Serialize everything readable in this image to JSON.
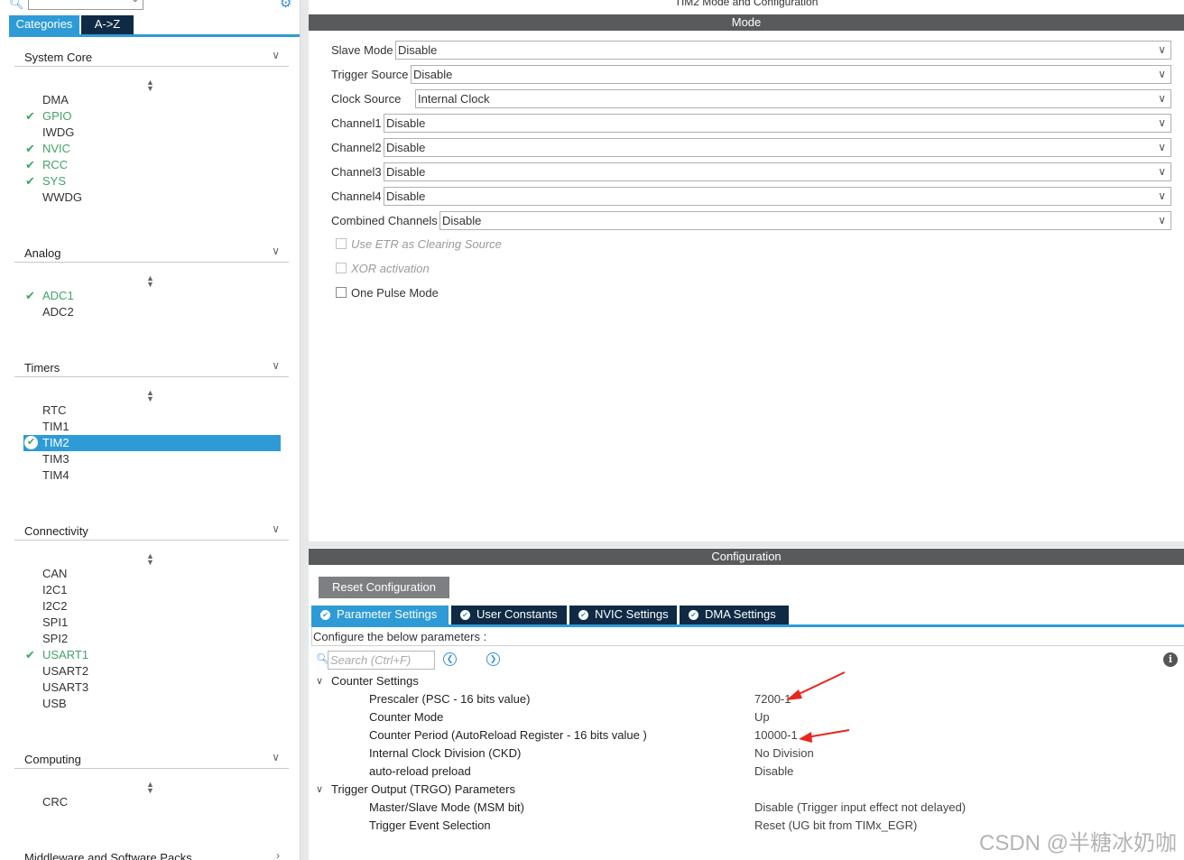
{
  "window_title": "TIM2 Mode and Configuration",
  "left": {
    "tabs": {
      "categories": "Categories",
      "az": "A->Z"
    },
    "categories": [
      {
        "name": "System Core",
        "items": [
          {
            "label": "DMA",
            "ok": false
          },
          {
            "label": "GPIO",
            "ok": true
          },
          {
            "label": "IWDG",
            "ok": false
          },
          {
            "label": "NVIC",
            "ok": true
          },
          {
            "label": "RCC",
            "ok": true
          },
          {
            "label": "SYS",
            "ok": true
          },
          {
            "label": "WWDG",
            "ok": false
          }
        ]
      },
      {
        "name": "Analog",
        "items": [
          {
            "label": "ADC1",
            "ok": true
          },
          {
            "label": "ADC2",
            "ok": false
          }
        ]
      },
      {
        "name": "Timers",
        "items": [
          {
            "label": "RTC",
            "ok": false
          },
          {
            "label": "TIM1",
            "ok": false
          },
          {
            "label": "TIM2",
            "ok": true,
            "selected": true
          },
          {
            "label": "TIM3",
            "ok": false
          },
          {
            "label": "TIM4",
            "ok": false
          }
        ]
      },
      {
        "name": "Connectivity",
        "items": [
          {
            "label": "CAN",
            "ok": false
          },
          {
            "label": "I2C1",
            "ok": false
          },
          {
            "label": "I2C2",
            "ok": false
          },
          {
            "label": "SPI1",
            "ok": false
          },
          {
            "label": "SPI2",
            "ok": false
          },
          {
            "label": "USART1",
            "ok": true
          },
          {
            "label": "USART2",
            "ok": false
          },
          {
            "label": "USART3",
            "ok": false
          },
          {
            "label": "USB",
            "ok": false
          }
        ]
      },
      {
        "name": "Computing",
        "items": [
          {
            "label": "CRC",
            "ok": false
          }
        ]
      },
      {
        "name": "Middleware and Software Packs",
        "items": []
      }
    ]
  },
  "mode": {
    "header": "Mode",
    "fields": [
      {
        "label": "Slave Mode",
        "value": "Disable"
      },
      {
        "label": "Trigger Source",
        "value": "Disable"
      },
      {
        "label": "Clock Source",
        "value": "Internal Clock"
      },
      {
        "label": "Channel1",
        "value": "Disable"
      },
      {
        "label": "Channel2",
        "value": "Disable"
      },
      {
        "label": "Channel3",
        "value": "Disable"
      },
      {
        "label": "Channel4",
        "value": "Disable"
      },
      {
        "label": "Combined Channels",
        "value": "Disable"
      }
    ],
    "checkboxes": [
      {
        "label": "Use ETR as Clearing Source",
        "disabled": true,
        "checked": false
      },
      {
        "label": "XOR activation",
        "disabled": true,
        "checked": false
      },
      {
        "label": "One Pulse Mode",
        "disabled": false,
        "checked": false
      }
    ]
  },
  "config": {
    "header": "Configuration",
    "reset_label": "Reset Configuration",
    "tabs": [
      "Parameter Settings",
      "User Constants",
      "NVIC Settings",
      "DMA Settings"
    ],
    "description": "Configure the below parameters :",
    "search_placeholder": "Search (Ctrl+F)",
    "groups": [
      {
        "name": "Counter Settings",
        "params": [
          {
            "name": "Prescaler (PSC - 16 bits value)",
            "value": "7200-1"
          },
          {
            "name": "Counter Mode",
            "value": "Up"
          },
          {
            "name": "Counter Period (AutoReload Register - 16 bits value )",
            "value": "10000-1"
          },
          {
            "name": "Internal Clock Division (CKD)",
            "value": "No Division"
          },
          {
            "name": "auto-reload preload",
            "value": "Disable"
          }
        ]
      },
      {
        "name": "Trigger Output (TRGO) Parameters",
        "params": [
          {
            "name": "Master/Slave Mode (MSM bit)",
            "value": "Disable (Trigger input effect not delayed)"
          },
          {
            "name": "Trigger Event Selection",
            "value": "Reset (UG bit from TIMx_EGR)"
          }
        ]
      }
    ]
  },
  "watermark": "CSDN @半糖冰奶咖",
  "colors": {
    "accent": "#2e9bd6",
    "dark_tab": "#0f2a45",
    "ok_green": "#43a36a",
    "header_bar": "#595a5c",
    "arrow_red": "#e8261c"
  }
}
